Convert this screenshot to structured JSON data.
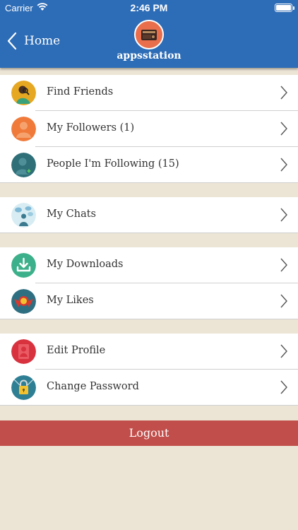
{
  "status_bar": {
    "carrier": "Carrier",
    "time": "2:46 PM"
  },
  "nav": {
    "back_label": "Home",
    "title": "appsstation"
  },
  "groups": [
    {
      "items": [
        {
          "label": "Find Friends",
          "icon": "find-friends-icon"
        },
        {
          "label": "My Followers  (1)",
          "icon": "followers-icon"
        },
        {
          "label": "People I'm Following  (15)",
          "icon": "following-icon"
        }
      ]
    },
    {
      "items": [
        {
          "label": "My Chats",
          "icon": "chats-icon"
        }
      ]
    },
    {
      "items": [
        {
          "label": "My Downloads",
          "icon": "download-icon"
        },
        {
          "label": "My Likes",
          "icon": "likes-icon"
        }
      ]
    },
    {
      "items": [
        {
          "label": "Edit Profile",
          "icon": "edit-profile-icon"
        },
        {
          "label": "Change Password",
          "icon": "lock-icon"
        }
      ]
    }
  ],
  "logout_label": "Logout",
  "colors": {
    "header": "#2d6cb6",
    "background": "#ece5d6",
    "logout": "#c14e4a"
  }
}
